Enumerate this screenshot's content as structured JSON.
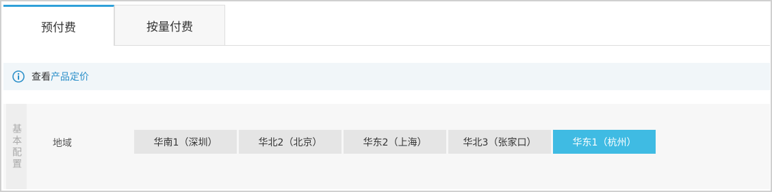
{
  "tabs": [
    {
      "label": "预付费",
      "active": true
    },
    {
      "label": "按量付费",
      "active": false
    }
  ],
  "info": {
    "icon": "info-icon",
    "text": "查看",
    "link": "产品定价"
  },
  "section": {
    "label": "基本配置",
    "field_label": "地域",
    "regions": [
      {
        "label": "华南1（深圳）",
        "selected": false
      },
      {
        "label": "华北2（北京）",
        "selected": false
      },
      {
        "label": "华东2（上海）",
        "selected": false
      },
      {
        "label": "华北3（张家口）",
        "selected": false
      },
      {
        "label": "华东1（杭州）",
        "selected": true
      }
    ]
  },
  "colors": {
    "accent": "#2ea0d8",
    "link": "#2a8fc9",
    "selected_region": "#3fbbe3",
    "info_bg": "#f1f6f9"
  }
}
